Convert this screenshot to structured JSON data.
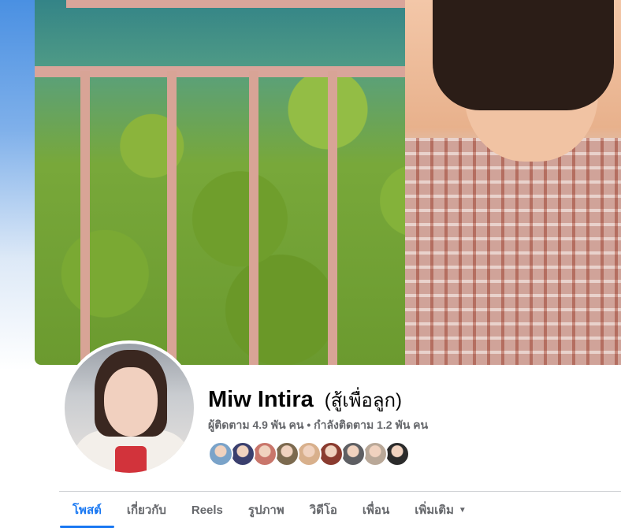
{
  "profile": {
    "name": "Miw Intira",
    "alternate_name": "(สู้เพื่อลูก)",
    "stats_text": "ผู้ติดตาม 4.9 พัน คน • กำลังติดตาม 1.2 พัน คน"
  },
  "mutual_friends": [
    {
      "color": "#7aa3c9"
    },
    {
      "color": "#3a3f6e"
    },
    {
      "color": "#c9766b"
    },
    {
      "color": "#7c6a4f"
    },
    {
      "color": "#d8b08c"
    },
    {
      "color": "#8a3b2f"
    },
    {
      "color": "#5e5f63"
    },
    {
      "color": "#b9a898"
    },
    {
      "color": "#2b2b2b"
    }
  ],
  "tabs": [
    {
      "label": "โพสต์",
      "active": true
    },
    {
      "label": "เกี่ยวกับ",
      "active": false
    },
    {
      "label": "Reels",
      "active": false
    },
    {
      "label": "รูปภาพ",
      "active": false
    },
    {
      "label": "วิดีโอ",
      "active": false
    },
    {
      "label": "เพื่อน",
      "active": false
    },
    {
      "label": "เพิ่มเติม",
      "active": false,
      "icon": "caret-down-icon"
    }
  ],
  "colors": {
    "accent": "#1877f2",
    "secondary_text": "#65676b",
    "primary_text": "#050505"
  }
}
